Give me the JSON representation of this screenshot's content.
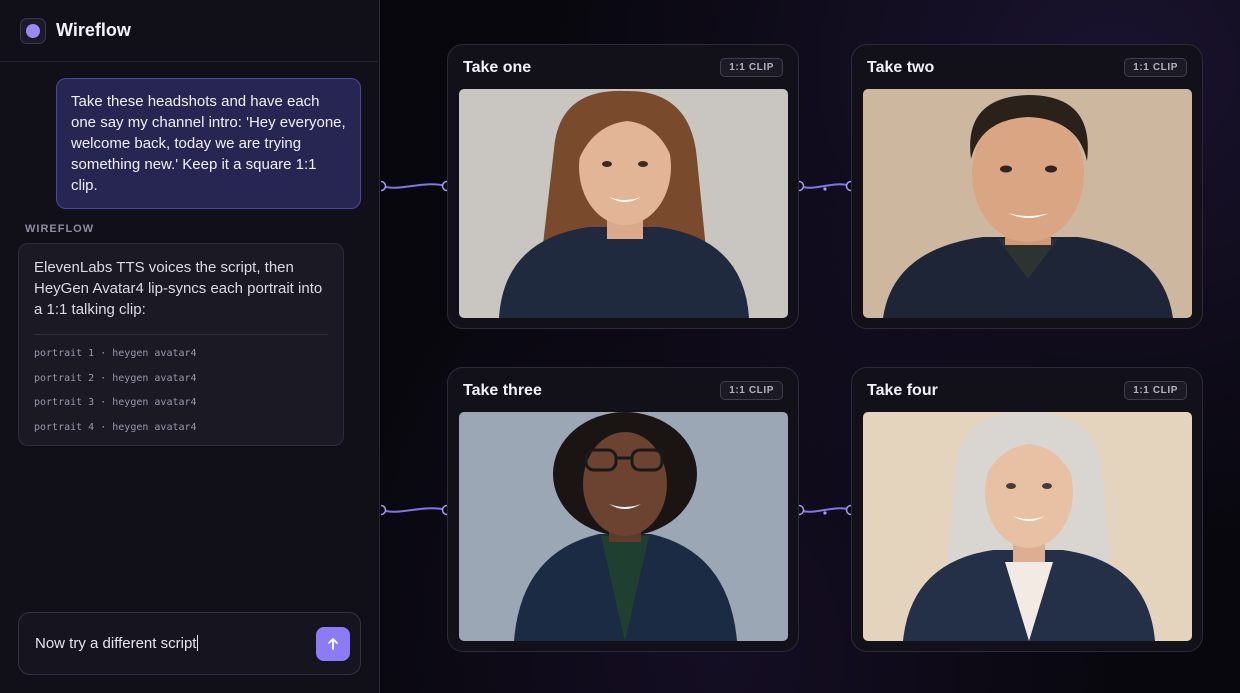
{
  "app": {
    "title": "Wireflow"
  },
  "chat": {
    "user_message": "Take these headshots and have each one say my channel intro: 'Hey everyone, welcome back, today we are trying something new.' Keep it a square 1:1 clip.",
    "assistant_label": "WIREFLOW",
    "assistant_message": "ElevenLabs TTS voices the script, then HeyGen Avatar4 lip-syncs each portrait into a 1:1 talking clip:",
    "steps": [
      "portrait 1 · heygen avatar4",
      "portrait 2 · heygen avatar4",
      "portrait 3 · heygen avatar4",
      "portrait 4 · heygen avatar4"
    ],
    "composer_value": "Now try a different script",
    "send_icon": "arrow-up-icon"
  },
  "nodes": [
    {
      "title": "Take one",
      "badge": "1:1 CLIP",
      "bg": "#c9c6c1",
      "skin": "#e2b596",
      "hair": "#7a4a2c",
      "jacket": "#1f2a3f"
    },
    {
      "title": "Take two",
      "badge": "1:1 CLIP",
      "bg": "#cdb79e",
      "skin": "#d9a582",
      "hair": "#2b211b",
      "jacket": "#1d2536"
    },
    {
      "title": "Take three",
      "badge": "1:1 CLIP",
      "bg": "#9ba7b4",
      "skin": "#6b4330",
      "hair": "#1a1412",
      "jacket": "#1c2b44"
    },
    {
      "title": "Take four",
      "badge": "1:1 CLIP",
      "bg": "#e5d4bd",
      "skin": "#e8c0a4",
      "hair": "#d9d6d1",
      "jacket": "#243048"
    }
  ],
  "colors": {
    "accent": "#8b7cf6",
    "connector": "#7f74e8"
  }
}
